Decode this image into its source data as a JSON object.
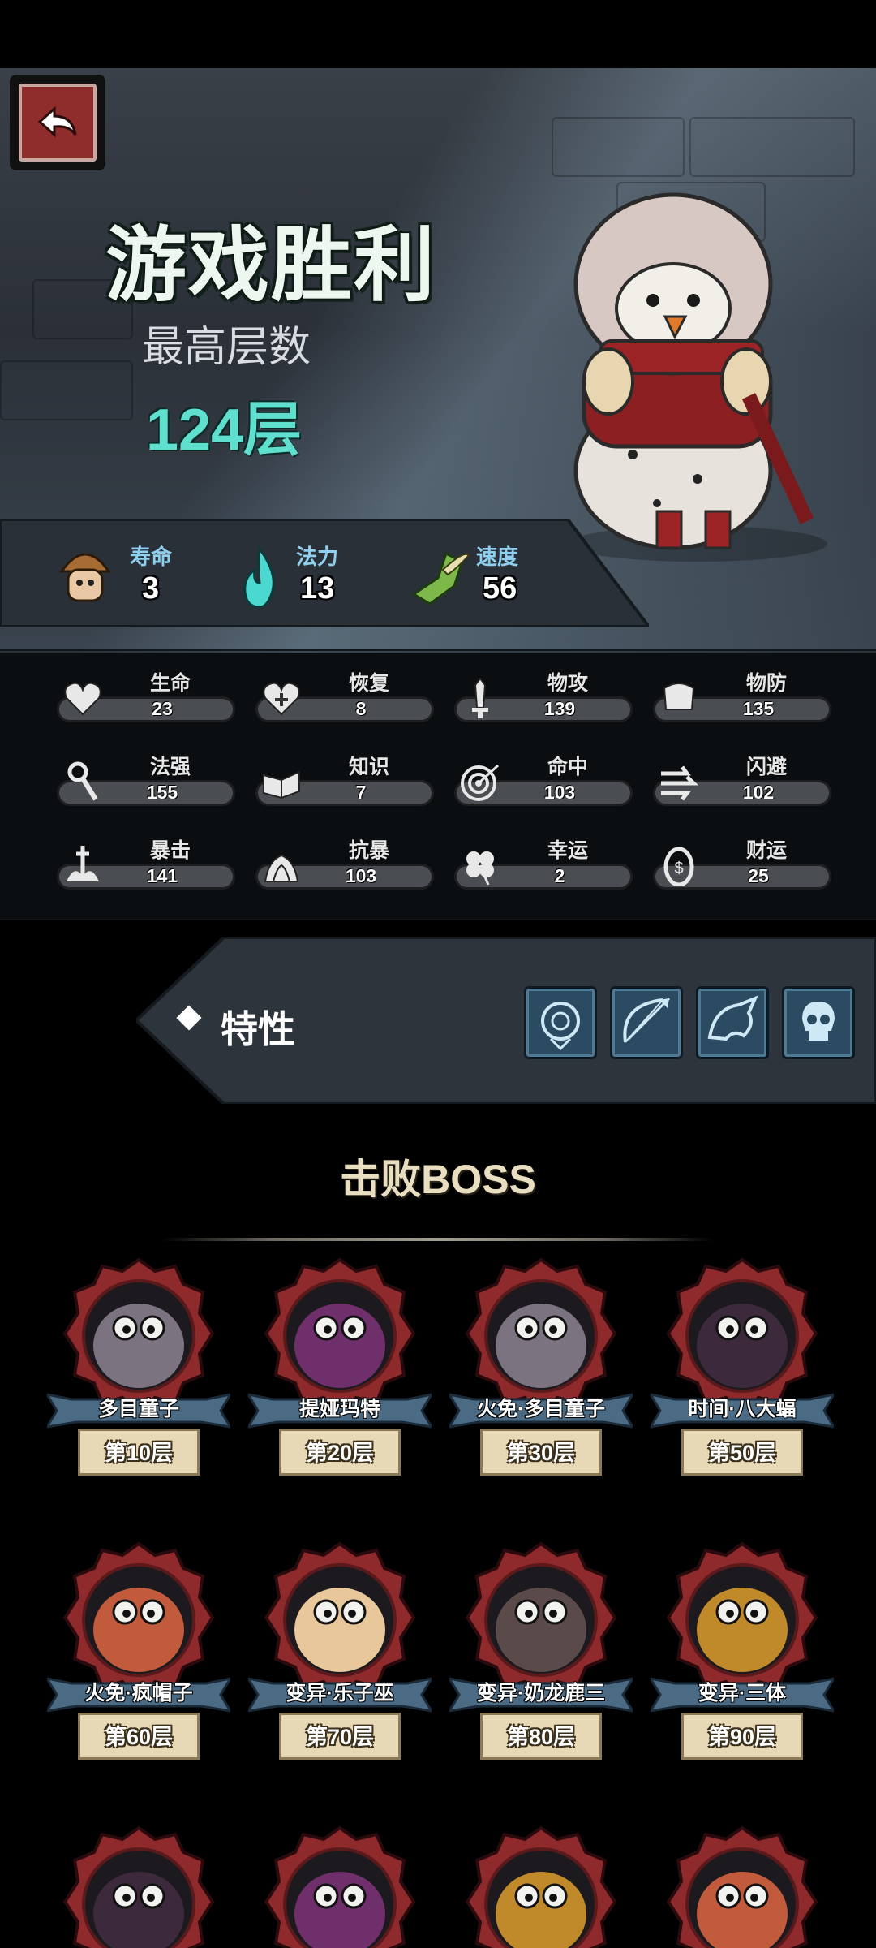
{
  "back_button": {
    "icon": "back-arrow-icon"
  },
  "result": {
    "title": "游戏胜利",
    "floor_label": "最高层数",
    "floor_value": "124层"
  },
  "core_stats": [
    {
      "label": "寿命",
      "value": "3",
      "icon": "mushroom-head-icon"
    },
    {
      "label": "法力",
      "value": "13",
      "icon": "blue-flame-icon"
    },
    {
      "label": "速度",
      "value": "56",
      "icon": "winged-boot-icon"
    }
  ],
  "stats": [
    {
      "label": "生命",
      "value": "23",
      "icon": "heart-icon"
    },
    {
      "label": "恢复",
      "value": "8",
      "icon": "heart-plus-icon"
    },
    {
      "label": "物攻",
      "value": "139",
      "icon": "sword-icon"
    },
    {
      "label": "物防",
      "value": "135",
      "icon": "armor-icon"
    },
    {
      "label": "法强",
      "value": "155",
      "icon": "staff-icon"
    },
    {
      "label": "知识",
      "value": "7",
      "icon": "book-icon"
    },
    {
      "label": "命中",
      "value": "103",
      "icon": "target-icon"
    },
    {
      "label": "闪避",
      "value": "102",
      "icon": "dodge-arrows-icon"
    },
    {
      "label": "暴击",
      "value": "141",
      "icon": "crit-dagger-icon"
    },
    {
      "label": "抗暴",
      "value": "103",
      "icon": "crit-resist-icon"
    },
    {
      "label": "幸运",
      "value": "2",
      "icon": "clover-icon"
    },
    {
      "label": "财运",
      "value": "25",
      "icon": "coin-icon"
    }
  ],
  "traits": {
    "label": "特性",
    "icons": [
      "frost-rose-icon",
      "bow-arrow-icon",
      "dragon-icon",
      "skull-icon"
    ]
  },
  "bosses": {
    "title": "击败BOSS",
    "items": [
      {
        "name": "多目童子",
        "floor": "第10层",
        "color": "#7b7380"
      },
      {
        "name": "提娅玛特",
        "floor": "第20层",
        "color": "#6e2f6a"
      },
      {
        "name": "火免·多目童子",
        "floor": "第30层",
        "color": "#7b7380"
      },
      {
        "name": "时间·八大蝠",
        "floor": "第50层",
        "color": "#3c2a3c"
      },
      {
        "name": "火免·疯帽子",
        "floor": "第60层",
        "color": "#c25a3c"
      },
      {
        "name": "变异·乐子巫",
        "floor": "第70层",
        "color": "#e8c89a"
      },
      {
        "name": "变异·奶龙鹿三",
        "floor": "第80层",
        "color": "#5a4a4a"
      },
      {
        "name": "变异·三体",
        "floor": "第90层",
        "color": "#c08a2a"
      }
    ],
    "partial_row_colors": [
      "#3c2a3c",
      "#6e2f6a",
      "#c08a2a",
      "#c25a3c"
    ]
  },
  "colors": {
    "accent_teal": "#5fe0cf",
    "frame_red": "#8e2d2b"
  }
}
